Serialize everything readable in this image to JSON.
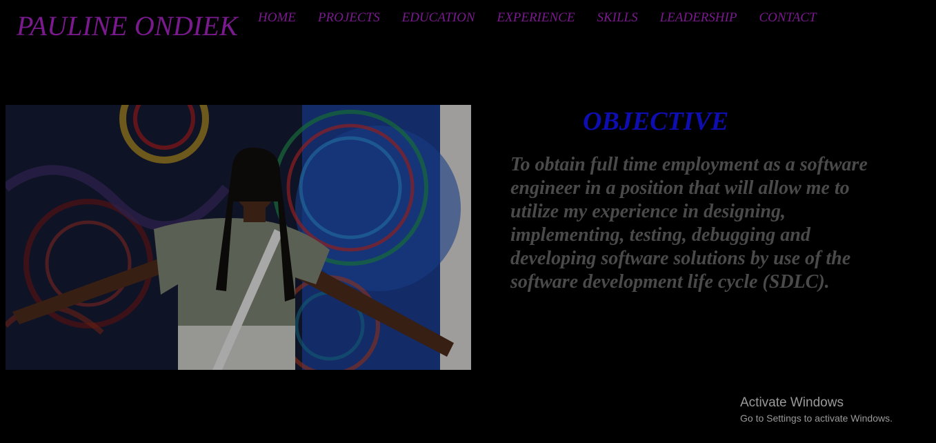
{
  "header": {
    "site_name": "PAULINE ONDIEK",
    "nav": [
      {
        "label": "HOME"
      },
      {
        "label": "PROJECTS"
      },
      {
        "label": "EDUCATION"
      },
      {
        "label": "EXPERIENCE"
      },
      {
        "label": "SKILLS"
      },
      {
        "label": "LEADERSHIP"
      },
      {
        "label": "CONTACT"
      }
    ]
  },
  "objective": {
    "title": "OBJECTIVE",
    "text": "To obtain full time employment as a software engineer in a position that will allow me to utilize my experience in designing, implementing, testing, debugging and developing software solutions by use of the software development life cycle (SDLC)."
  },
  "watermark": {
    "title": "Activate Windows",
    "subtitle": "Go to Settings to activate Windows."
  },
  "colors": {
    "background": "#000000",
    "brand_purple": "#7a1a8e",
    "objective_blue": "#0d0db0",
    "body_text": "#4a4a4a"
  }
}
